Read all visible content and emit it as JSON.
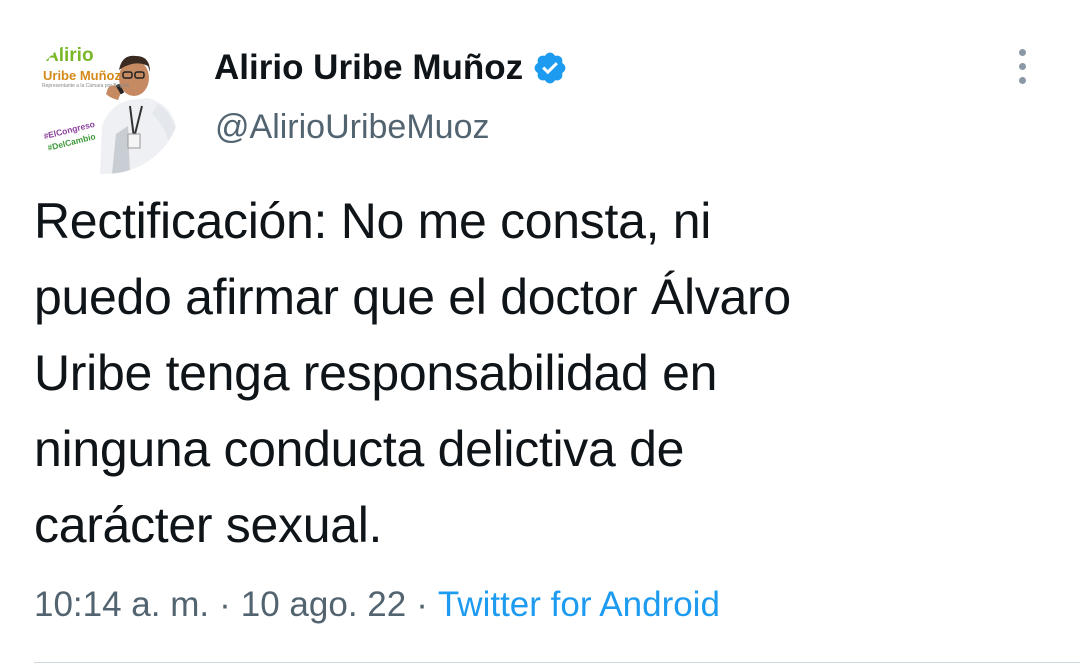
{
  "author": {
    "display_name": "Alirio Uribe Muñoz",
    "handle": "@AlirioUribeMuoz",
    "verified": true,
    "avatar": {
      "logo_line1": "Alirio",
      "logo_line2": "Uribe Muñoz",
      "logo_subtitle": "Representante a la Cámara por Bogotá",
      "hashtag_line1": "#ElCongreso",
      "hashtag_line2": "#DelCambio"
    }
  },
  "tweet": {
    "text_lines": [
      "Rectificación: No me consta, ni",
      "puedo afirmar que el doctor Álvaro",
      "Uribe tenga responsabilidad en",
      "ninguna conducta delictiva de",
      "carácter sexual."
    ],
    "time": "10:14 a. m.",
    "date": "10 ago. 22",
    "separator": "·",
    "source": "Twitter for Android"
  },
  "icons": {
    "verified": "verified-badge-icon",
    "more": "more-options-icon"
  },
  "colors": {
    "text_primary": "#0f1419",
    "text_secondary": "#536471",
    "accent": "#1d9bf0"
  }
}
